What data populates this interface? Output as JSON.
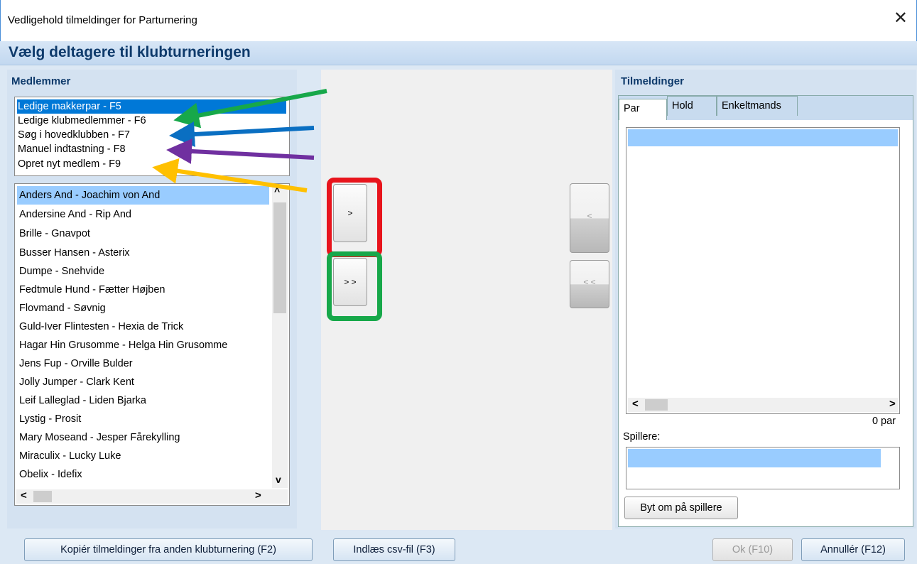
{
  "window": {
    "title": "Vedligehold tilmeldinger for Parturnering",
    "close_glyph": "✕"
  },
  "header": {
    "title": "Vælg deltagere til klubturneringen"
  },
  "left": {
    "section_label": "Medlemmer",
    "source_options": [
      {
        "label": "Ledige makkerpar - F5",
        "selected": true
      },
      {
        "label": "Ledige klubmedlemmer - F6",
        "selected": false
      },
      {
        "label": "Søg i hovedklubben - F7",
        "selected": false
      },
      {
        "label": "Manuel indtastning - F8",
        "selected": false
      },
      {
        "label": "Opret nyt medlem - F9",
        "selected": false
      }
    ],
    "members": [
      "Anders And - Joachim von And",
      "Andersine And - Rip And",
      "Brille - Gnavpot",
      "Busser Hansen - Asterix",
      "Dumpe - Snehvide",
      "Fedtmule Hund - Fætter Højben",
      "Flovmand - Søvnig",
      "Guld-Iver Flintesten - Hexia de Trick",
      "Hagar Hin Grusomme - Helga Hin Grusomme",
      "Jens Fup - Orville Bulder",
      "Jolly Jumper - Clark Kent",
      "Leif Lalleglad - Liden Bjarka",
      "Lystig - Prosit",
      "Mary Moseand - Jesper Fårekylling",
      "Miraculix - Lucky Luke",
      "Obelix - Idefix"
    ],
    "scroll_up": "^",
    "scroll_down": "v",
    "scroll_left": "<",
    "scroll_right": ">"
  },
  "middle": {
    "add_one": ">",
    "add_all": "> >",
    "remove_one": "<",
    "remove_all": "< <"
  },
  "right": {
    "section_label": "Tilmeldinger",
    "tabs": [
      "Par",
      "Hold",
      "Enkeltmands"
    ],
    "count_text": "0 par",
    "players_label": "Spillere:",
    "swap_button": "Byt om på spillere",
    "scroll_left": "<",
    "scroll_right": ">"
  },
  "footer": {
    "copy_button": "Kopiér tilmeldinger fra anden klubturnering (F2)",
    "import_button": "Indlæs csv-fil (F3)",
    "ok_button": "Ok (F10)",
    "cancel_button": "Annullér (F12)"
  },
  "annotation_colors": {
    "green": "#17a84a",
    "blue": "#0a6fc2",
    "purple": "#7030a0",
    "orange": "#ffc000",
    "red": "#e8141c"
  }
}
